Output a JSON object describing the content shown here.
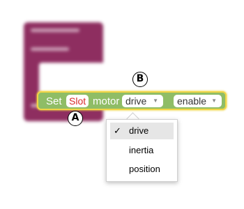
{
  "block": {
    "set_label": "Set",
    "slot_value": "Slot",
    "motor_label": "motor",
    "property_value": "drive",
    "state_value": "enable",
    "dropdown_caret": "▼",
    "colors": {
      "block_fill": "#8fbd66",
      "highlight_border": "#f0d545",
      "slot_text": "#d92b2b",
      "background_block": "#8e2e60"
    }
  },
  "dropdown_menu": {
    "check_icon": "✓",
    "items": [
      {
        "label": "drive",
        "selected": true
      },
      {
        "label": "inertia",
        "selected": false
      },
      {
        "label": "position",
        "selected": false
      }
    ]
  },
  "annotations": {
    "marker_a": "A",
    "marker_b": "B"
  }
}
